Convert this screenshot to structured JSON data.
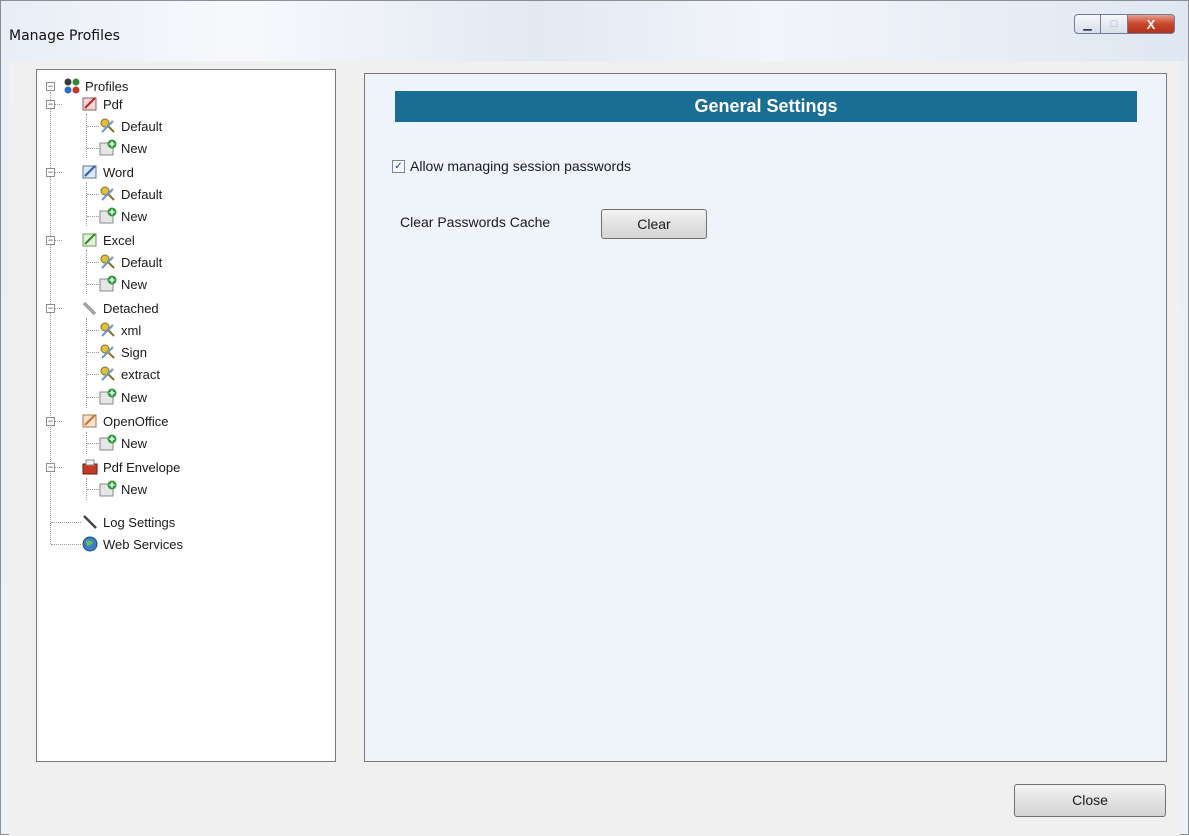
{
  "window": {
    "title": "Manage Profiles",
    "caption_buttons": {
      "minimize": "▁",
      "maximize": "□",
      "close": "X"
    }
  },
  "tree": {
    "root_label": "Profiles",
    "nodes": [
      {
        "label": "Pdf",
        "icon": "pdf-profile-icon"
      },
      {
        "label": "Default",
        "icon": "key-icon"
      },
      {
        "label": "New",
        "icon": "new-profile-icon"
      },
      {
        "label": "Word",
        "icon": "word-profile-icon"
      },
      {
        "label": "Default",
        "icon": "key-icon"
      },
      {
        "label": "New",
        "icon": "new-profile-icon"
      },
      {
        "label": "Excel",
        "icon": "excel-profile-icon"
      },
      {
        "label": "Default",
        "icon": "key-icon"
      },
      {
        "label": "New",
        "icon": "new-profile-icon"
      },
      {
        "label": "Detached",
        "icon": "detached-icon"
      },
      {
        "label": "xml",
        "icon": "key-icon"
      },
      {
        "label": "Sign",
        "icon": "key-icon"
      },
      {
        "label": "extract",
        "icon": "key-icon"
      },
      {
        "label": "New",
        "icon": "new-profile-icon"
      },
      {
        "label": "OpenOffice",
        "icon": "openoffice-profile-icon"
      },
      {
        "label": "New",
        "icon": "new-profile-icon"
      },
      {
        "label": "Pdf Envelope",
        "icon": "envelope-icon"
      },
      {
        "label": "New",
        "icon": "new-profile-icon"
      },
      {
        "label": "Log Settings",
        "icon": "pen-icon"
      },
      {
        "label": "Web Services",
        "icon": "globe-icon"
      }
    ],
    "expander_glyph": "−"
  },
  "settings": {
    "header": "General Settings",
    "allow_managing_label": "Allow managing session passwords",
    "allow_managing_checked": true,
    "checkmark_glyph": "✓",
    "clear_cache_label": "Clear Passwords Cache",
    "clear_button": "Clear"
  },
  "footer": {
    "close_button": "Close"
  },
  "colors": {
    "header_bg": "#1a6e94",
    "panel_bg": "#eef4fa",
    "close_caption_red": "#c8452d"
  }
}
